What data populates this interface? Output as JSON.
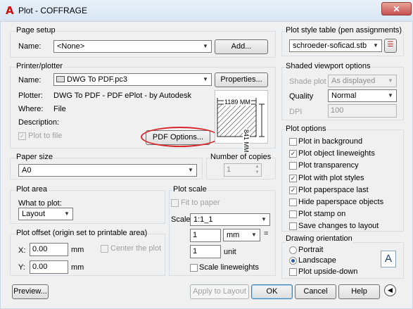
{
  "window": {
    "title": "Plot - COFFRAGE",
    "app_icon": "A"
  },
  "page_setup": {
    "label": "Page setup",
    "name_label": "Name:",
    "name_value": "<None>",
    "add_button": "Add..."
  },
  "printer": {
    "label": "Printer/plotter",
    "name_label": "Name:",
    "name_value": "DWG To PDF.pc3",
    "properties_button": "Properties...",
    "plotter_label": "Plotter:",
    "plotter_value": "DWG To PDF - PDF ePlot - by Autodesk",
    "where_label": "Where:",
    "where_value": "File",
    "description_label": "Description:",
    "plot_to_file_label": "Plot to file",
    "pdf_options_button": "PDF Options...",
    "preview_width": "1189 MM",
    "preview_height": "841 MM"
  },
  "paper_size": {
    "label": "Paper size",
    "value": "A0"
  },
  "copies": {
    "label": "Number of copies",
    "value": "1"
  },
  "plot_area": {
    "label": "Plot area",
    "what_label": "What to plot:",
    "value": "Layout"
  },
  "plot_scale": {
    "label": "Plot scale",
    "fit_label": "Fit to paper",
    "scale_label": "Scale:",
    "scale_value": "1:1_1",
    "value1": "1",
    "unit_value": "mm",
    "equals": "=",
    "value2": "1",
    "unit_label": "unit",
    "lineweights_label": "Scale lineweights"
  },
  "plot_offset": {
    "label": "Plot offset (origin set to printable area)",
    "x_label": "X:",
    "x_value": "0.00",
    "x_unit": "mm",
    "y_label": "Y:",
    "y_value": "0.00",
    "y_unit": "mm",
    "center_label": "Center the plot"
  },
  "plot_style_table": {
    "label": "Plot style table (pen assignments)",
    "value": "schroeder-soficad.stb"
  },
  "shaded_viewport": {
    "label": "Shaded viewport options",
    "shade_plot_label": "Shade plot",
    "shade_plot_value": "As displayed",
    "quality_label": "Quality",
    "quality_value": "Normal",
    "dpi_label": "DPI",
    "dpi_value": "100"
  },
  "plot_options": {
    "label": "Plot options",
    "items": [
      {
        "label": "Plot in background",
        "checked": false
      },
      {
        "label": "Plot object lineweights",
        "checked": true
      },
      {
        "label": "Plot transparency",
        "checked": false
      },
      {
        "label": "Plot with plot styles",
        "checked": true
      },
      {
        "label": "Plot paperspace last",
        "checked": true
      },
      {
        "label": "Hide paperspace objects",
        "checked": false
      },
      {
        "label": "Plot stamp on",
        "checked": false
      },
      {
        "label": "Save changes to layout",
        "checked": false
      }
    ]
  },
  "drawing_orientation": {
    "label": "Drawing orientation",
    "portrait": "Portrait",
    "landscape": "Landscape",
    "upside_down": "Plot upside-down",
    "selected": "Landscape",
    "icon_letter": "A"
  },
  "footer": {
    "preview": "Preview...",
    "apply": "Apply to Layout",
    "ok": "OK",
    "cancel": "Cancel",
    "help": "Help"
  },
  "colors": {
    "highlight": "#d8262a",
    "accent": "#d01010"
  },
  "icons": [
    "autocad-logo-icon",
    "close-icon",
    "plot-style-edit-icon",
    "collapse-icon",
    "dropdown-arrow-icon"
  ]
}
